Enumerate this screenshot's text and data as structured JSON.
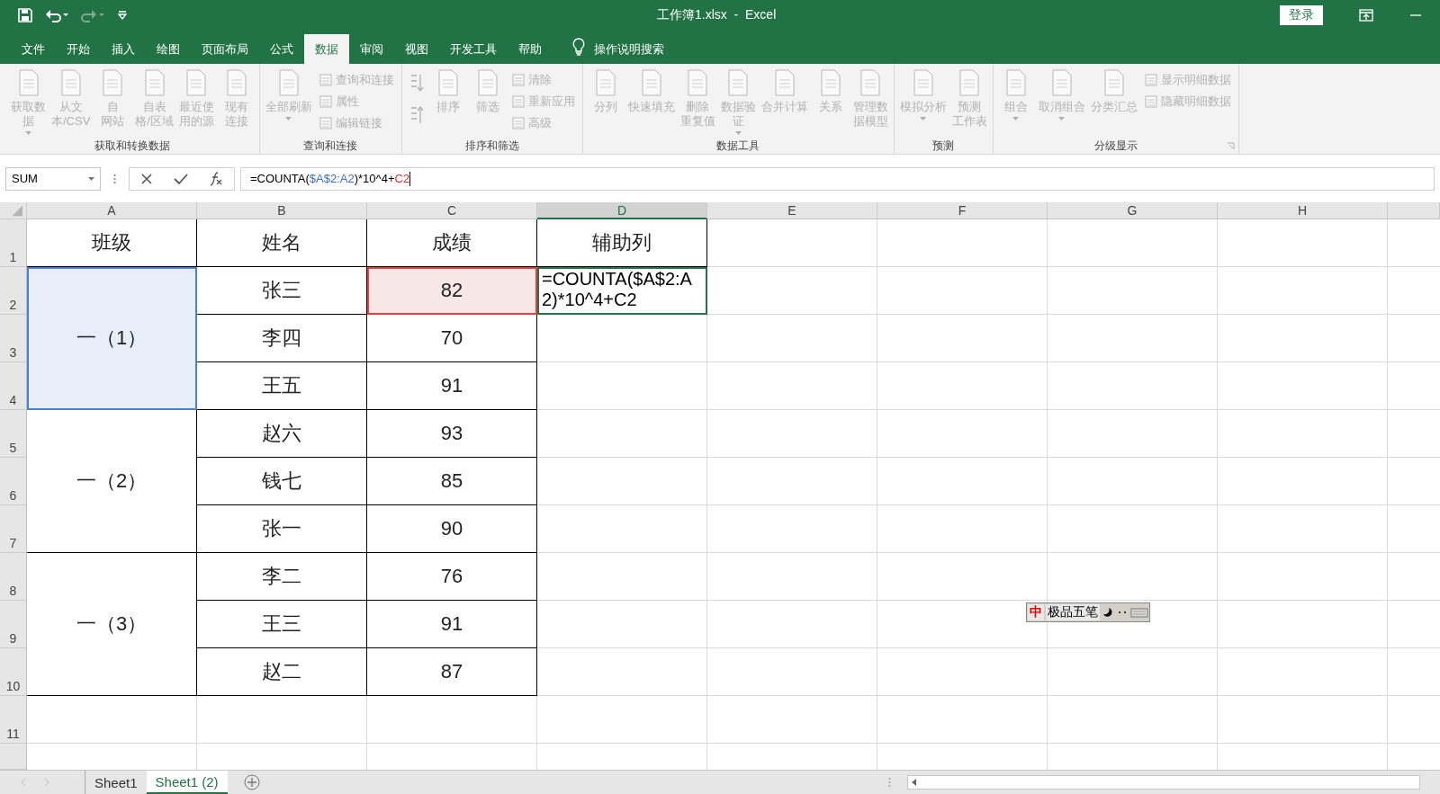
{
  "title_bar": {
    "title": "工作簿1.xlsx  -  Excel",
    "login": "登录"
  },
  "menu_tabs": [
    {
      "label": "文件",
      "selected": false
    },
    {
      "label": "开始",
      "selected": false
    },
    {
      "label": "插入",
      "selected": false
    },
    {
      "label": "绘图",
      "selected": false
    },
    {
      "label": "页面布局",
      "selected": false
    },
    {
      "label": "公式",
      "selected": false
    },
    {
      "label": "数据",
      "selected": true
    },
    {
      "label": "审阅",
      "selected": false
    },
    {
      "label": "视图",
      "selected": false
    },
    {
      "label": "开发工具",
      "selected": false
    },
    {
      "label": "帮助",
      "selected": false
    }
  ],
  "tell_me": "操作说明搜索",
  "ribbon_groups": [
    {
      "label": "获取和转换数据",
      "launcher": false,
      "items": [
        {
          "kind": "large",
          "lines": [
            "获取数",
            "据"
          ],
          "dropdown": true
        },
        {
          "kind": "large",
          "lines": [
            "从文",
            "本/CSV"
          ],
          "dropdown": false
        },
        {
          "kind": "large",
          "lines": [
            "自",
            "网站"
          ],
          "dropdown": false
        },
        {
          "kind": "large",
          "lines": [
            "自表",
            "格/区域"
          ],
          "dropdown": false
        },
        {
          "kind": "large",
          "lines": [
            "最近使",
            "用的源"
          ],
          "dropdown": false
        },
        {
          "kind": "large",
          "lines": [
            "现有",
            "连接"
          ],
          "dropdown": false
        }
      ]
    },
    {
      "label": "查询和连接",
      "launcher": false,
      "items": [
        {
          "kind": "large",
          "lines": [
            "全部刷新"
          ],
          "dropdown": true
        },
        {
          "kind": "stack",
          "entries": [
            "查询和连接",
            "属性",
            "编辑链接"
          ]
        }
      ]
    },
    {
      "label": "排序和筛选",
      "launcher": false,
      "items": [
        {
          "kind": "sort"
        },
        {
          "kind": "large",
          "lines": [
            "排序"
          ],
          "dropdown": false
        },
        {
          "kind": "large",
          "lines": [
            "筛选"
          ],
          "dropdown": false
        },
        {
          "kind": "stack",
          "entries": [
            "清除",
            "重新应用",
            "高级"
          ]
        }
      ]
    },
    {
      "label": "数据工具",
      "launcher": false,
      "items": [
        {
          "kind": "large",
          "lines": [
            "分列"
          ],
          "dropdown": false
        },
        {
          "kind": "large",
          "lines": [
            "快速填充"
          ],
          "dropdown": false
        },
        {
          "kind": "large",
          "lines": [
            "删除",
            "重复值"
          ],
          "dropdown": false
        },
        {
          "kind": "large",
          "lines": [
            "数据验",
            "证"
          ],
          "dropdown": true
        },
        {
          "kind": "large",
          "lines": [
            "合并计算"
          ],
          "dropdown": false
        },
        {
          "kind": "large",
          "lines": [
            "关系"
          ],
          "dropdown": false
        },
        {
          "kind": "large",
          "lines": [
            "管理数",
            "据模型"
          ],
          "dropdown": false
        }
      ]
    },
    {
      "label": "预测",
      "launcher": false,
      "items": [
        {
          "kind": "large",
          "lines": [
            "模拟分析"
          ],
          "dropdown": true
        },
        {
          "kind": "large",
          "lines": [
            "预测",
            "工作表"
          ],
          "dropdown": false
        }
      ]
    },
    {
      "label": "分级显示",
      "launcher": true,
      "items": [
        {
          "kind": "large",
          "lines": [
            "组合"
          ],
          "dropdown": true
        },
        {
          "kind": "large",
          "lines": [
            "取消组合"
          ],
          "dropdown": true
        },
        {
          "kind": "large",
          "lines": [
            "分类汇总"
          ],
          "dropdown": false
        },
        {
          "kind": "stack",
          "entries": [
            "显示明细数据",
            "隐藏明细数据"
          ]
        }
      ]
    }
  ],
  "name_box": "SUM",
  "formula": [
    {
      "text": "=COUNTA(",
      "color": "#000000"
    },
    {
      "text": "$A$2:A2",
      "color": "#3b6fd8"
    },
    {
      "text": ")*10^4+",
      "color": "#000000"
    },
    {
      "text": "C2",
      "color": "#e03030"
    }
  ],
  "columns": [
    {
      "label": "A",
      "selected": false
    },
    {
      "label": "B",
      "selected": false
    },
    {
      "label": "C",
      "selected": false
    },
    {
      "label": "D",
      "selected": true
    },
    {
      "label": "E",
      "selected": false
    },
    {
      "label": "F",
      "selected": false
    },
    {
      "label": "G",
      "selected": false
    },
    {
      "label": "H",
      "selected": false
    }
  ],
  "row_numbers": [
    "1",
    "2",
    "3",
    "4",
    "5",
    "6",
    "7",
    "8",
    "9",
    "10",
    "11"
  ],
  "header_row": [
    "班级",
    "姓名",
    "成绩",
    "辅助列"
  ],
  "groups": [
    {
      "class": "一（1）",
      "highlighted": true,
      "students": [
        {
          "name": "张三",
          "score": "82",
          "score_highlighted": true,
          "helper": "=COUNTA($A$2:A2)*10^4+C2"
        },
        {
          "name": "李四",
          "score": "70",
          "score_highlighted": false
        },
        {
          "name": "王五",
          "score": "91",
          "score_highlighted": false
        }
      ]
    },
    {
      "class": "一（2）",
      "highlighted": false,
      "students": [
        {
          "name": "赵六",
          "score": "93",
          "score_highlighted": false
        },
        {
          "name": "钱七",
          "score": "85",
          "score_highlighted": false
        },
        {
          "name": "张一",
          "score": "90",
          "score_highlighted": false
        }
      ]
    },
    {
      "class": "一（3）",
      "highlighted": false,
      "students": [
        {
          "name": "李二",
          "score": "76",
          "score_highlighted": false
        },
        {
          "name": "王三",
          "score": "91",
          "score_highlighted": false
        },
        {
          "name": "赵二",
          "score": "87",
          "score_highlighted": false
        }
      ]
    }
  ],
  "sheet_tabs": [
    {
      "label": "Sheet1",
      "selected": false
    },
    {
      "label": "Sheet1 (2)",
      "selected": true
    }
  ],
  "ime_bar": {
    "mode": "中",
    "name": "极品五笔"
  }
}
